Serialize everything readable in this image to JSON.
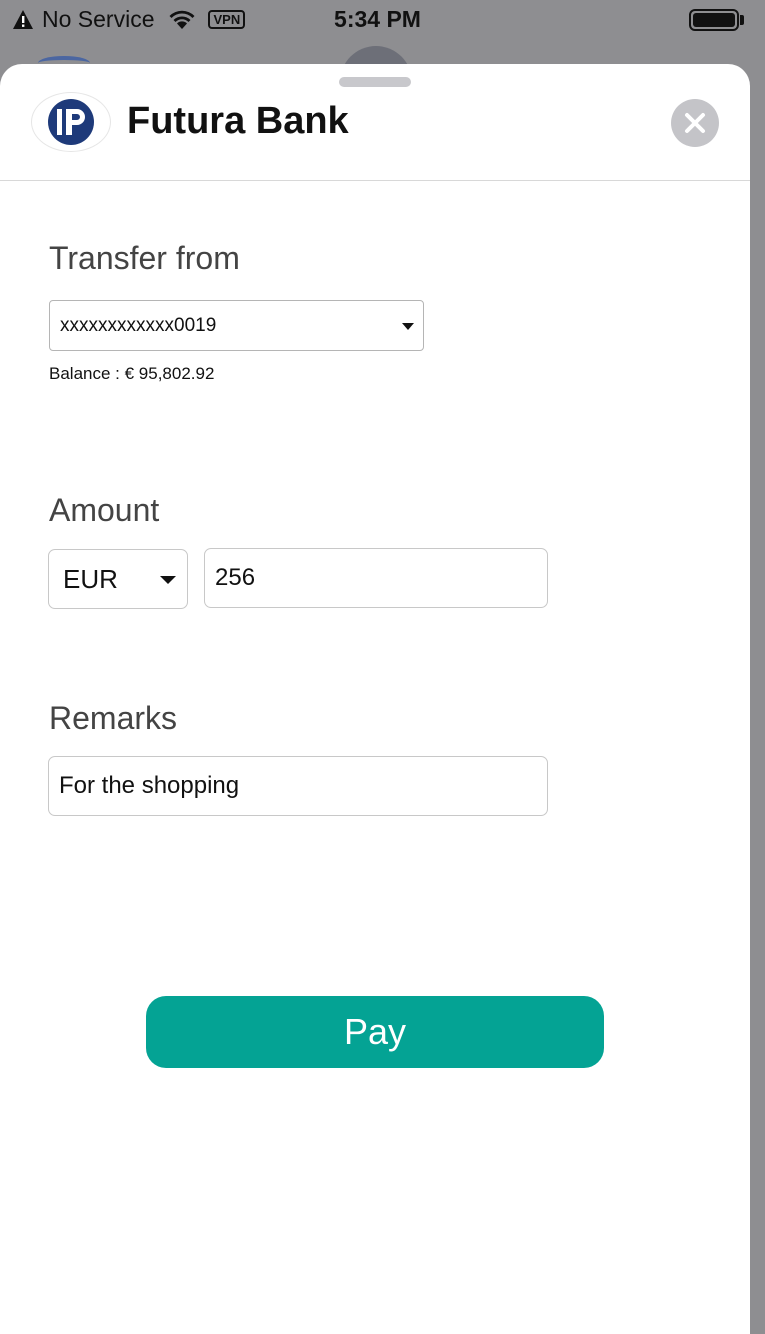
{
  "status_bar": {
    "carrier": "No Service",
    "vpn": "VPN",
    "time": "5:34 PM"
  },
  "header": {
    "bank_name": "Futura Bank",
    "logo_icon": "futura-bank-logo",
    "close_icon": "close-icon"
  },
  "transfer_from": {
    "label": "Transfer from",
    "selected_account": "xxxxxxxxxxxx0019",
    "balance_label": "Balance :",
    "balance_value": "€ 95,802.92"
  },
  "amount": {
    "label": "Amount",
    "currency": "EUR",
    "value": "256"
  },
  "remarks": {
    "label": "Remarks",
    "value": "For the shopping"
  },
  "actions": {
    "pay_label": "Pay"
  },
  "colors": {
    "accent": "#04a394",
    "brand": "#1e3a7a"
  }
}
